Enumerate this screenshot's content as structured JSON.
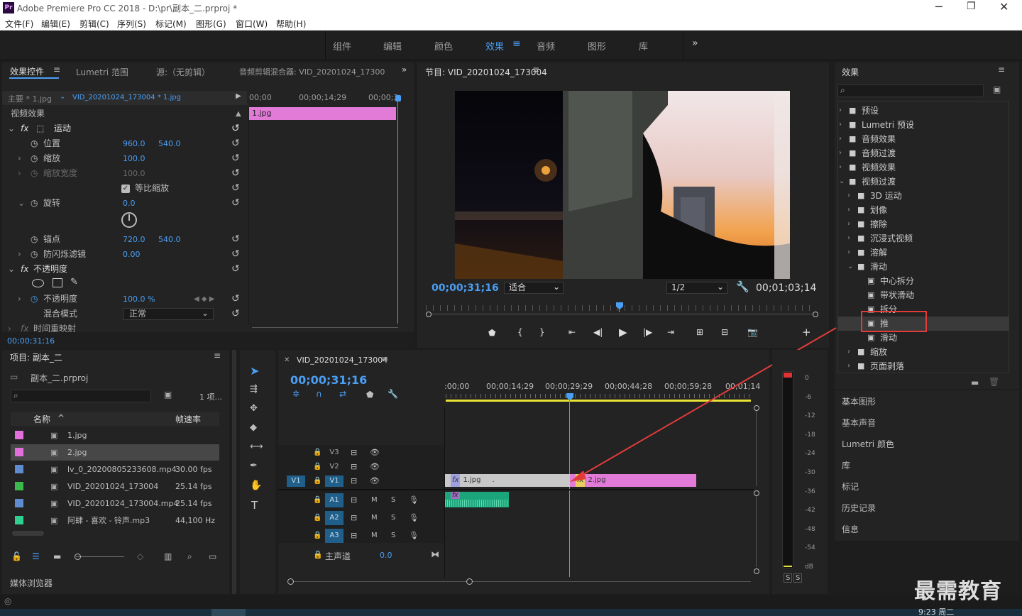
{
  "app": {
    "title": "Adobe Premiere Pro CC 2018 - D:\\pr\\副本_二.prproj *",
    "logo": "Pr"
  },
  "menu": [
    "文件(F)",
    "编辑(E)",
    "剪辑(C)",
    "序列(S)",
    "标记(M)",
    "图形(G)",
    "窗口(W)",
    "帮助(H)"
  ],
  "workspaces": [
    "组件",
    "编辑",
    "颜色",
    "效果",
    "音频",
    "图形",
    "库"
  ],
  "active_workspace": "效果",
  "ec": {
    "tabs": [
      "效果控件",
      "Lumetri 范围",
      "源:（无剪辑）",
      "音频剪辑混合器: VID_20201024_17300"
    ],
    "master": "主要 * 1.jpg",
    "clip": "VID_20201024_173004 * 1.jpg",
    "ruler": [
      "00;00",
      "00;00;14;29",
      "00;00;3"
    ],
    "clip_bar": "1.jpg",
    "section_video": "视频效果",
    "motion": "运动",
    "position": {
      "label": "位置",
      "x": "960.0",
      "y": "540.0"
    },
    "scale": {
      "label": "缩放",
      "v": "100.0"
    },
    "scale_w": {
      "label": "缩放宽度",
      "v": "100.0"
    },
    "uniform": "等比缩放",
    "rotation": {
      "label": "旋转",
      "v": "0.0"
    },
    "anchor": {
      "label": "锚点",
      "x": "720.0",
      "y": "540.0"
    },
    "flicker": {
      "label": "防闪烁滤镜",
      "v": "0.00"
    },
    "opacity_section": "不透明度",
    "opacity": {
      "label": "不透明度",
      "v": "100.0 %"
    },
    "blend": {
      "label": "混合模式",
      "v": "正常"
    },
    "remap": "时间重映射",
    "timecode": "00;00;31;16"
  },
  "program": {
    "title": "节目: VID_20201024_173004",
    "tc": "00;00;31;16",
    "fit": "适合",
    "quality": "1/2",
    "duration": "00;01;03;14"
  },
  "effects": {
    "title": "效果",
    "top": [
      "预设",
      "Lumetri 预设",
      "音频效果",
      "音频过渡",
      "视频效果",
      "视频过渡"
    ],
    "vt": [
      "3D 运动",
      "划像",
      "擦除",
      "沉浸式视频",
      "溶解",
      "滑动"
    ],
    "slide": [
      "中心拆分",
      "带状滑动",
      "拆分",
      "推",
      "滑动"
    ],
    "more": [
      "缩放",
      "页面剥落"
    ],
    "panels": [
      "基本图形",
      "基本声音",
      "Lumetri 颜色",
      "库",
      "标记",
      "历史记录",
      "信息"
    ]
  },
  "project": {
    "title": "项目: 副本_二",
    "file": "副本_二.prproj",
    "count": "1 项...",
    "col_name": "名称",
    "col_fps": "帧速率",
    "items": [
      {
        "name": "1.jpg",
        "fps": "",
        "color": "#e36fdc"
      },
      {
        "name": "2.jpg",
        "fps": "",
        "color": "#e36fdc"
      },
      {
        "name": "lv_0_20200805233608.mp4",
        "fps": "30.00 fps",
        "color": "#5f8bd0"
      },
      {
        "name": "VID_20201024_173004",
        "fps": "25.14 fps",
        "color": "#3cb84c"
      },
      {
        "name": "VID_20201024_173004.mp4",
        "fps": "25.14 fps",
        "color": "#5f8bd0"
      },
      {
        "name": "阿肆 - 喜欢 - 铃声.mp3",
        "fps": "44,100 Hz",
        "color": "#2fcf8f"
      }
    ],
    "media": "媒体浏览器"
  },
  "timeline": {
    "title": "VID_20201024_173004",
    "tc": "00;00;31;16",
    "ruler": [
      ":00;00",
      "00;00;14;29",
      "00;00;29;29",
      "00;00;44;28",
      "00;00;59;28",
      "00;01;14"
    ],
    "tracks_v": [
      "V3",
      "V2",
      "V1"
    ],
    "tracks_a": [
      "A1",
      "A2",
      "A3"
    ],
    "src_v": "V1",
    "master": "主声道",
    "master_v": "0.0",
    "clip1": "1.jpg",
    "clip2": "2.jpg"
  },
  "meter": [
    "0",
    "-6",
    "-12",
    "-18",
    "-24",
    "-30",
    "-36",
    "-42",
    "-48",
    "-54",
    "dB"
  ],
  "watermark": "最需教育",
  "taskbar_time": "9:23 周二"
}
